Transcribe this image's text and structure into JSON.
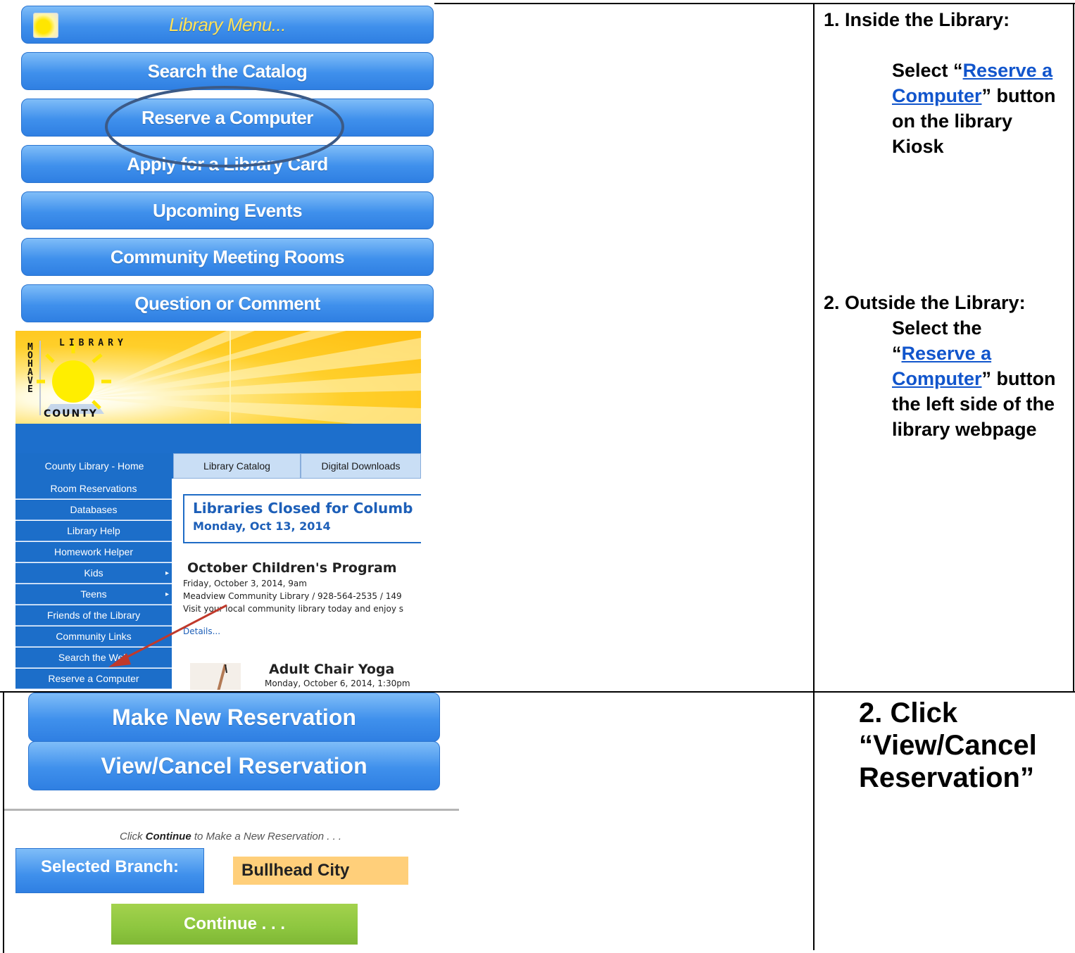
{
  "kiosk_menu": {
    "title": "Library Menu...",
    "buttons": [
      "Search the Catalog",
      "Reserve a Computer",
      "Apply for a Library Card",
      "Upcoming Events",
      "Community Meeting Rooms",
      "Question or Comment"
    ]
  },
  "website": {
    "logo_letters": {
      "left": "MOHAVE",
      "arc": "LIBRARY",
      "bottom": "COUNTY"
    },
    "top_nav": [
      "County Library - Home",
      "Library Catalog",
      "Digital Downloads"
    ],
    "side_nav": [
      "Room Reservations",
      "Databases",
      "Library Help",
      "Homework Helper",
      "Kids",
      "Teens",
      "Friends of the Library",
      "Community Links",
      "Search the Web",
      "Reserve a Computer"
    ],
    "notice_title": "Libraries Closed for Columb",
    "notice_date": "Monday, Oct 13, 2014",
    "event1_title": "October Children's Program",
    "event1_date": "Friday, October 3, 2014, 9am",
    "event1_location": "Meadview Community Library / 928-564-2535 / 149",
    "event1_desc": "Visit your local community library today and enjoy s",
    "event1_more": "Details...",
    "event2_title": "Adult Chair Yoga",
    "event2_date": "Monday, October 6, 2014, 1:30pm"
  },
  "instructions": {
    "step1_title": "1. Inside the Library:",
    "step1_pre": "Select “",
    "step1_link": "Reserve a Computer",
    "step1_post": "” button on the library Kiosk",
    "step2_title": "2. Outside the Library:",
    "step2_pre": "Select the “",
    "step2_link": "Reserve a Computer",
    "step2_post": "” button the left side of the library webpage",
    "step3_line1": "2.  Click",
    "step3_line2": "“View/Cancel",
    "step3_line3": "Reservation”"
  },
  "reservation": {
    "make_new": "Make New Reservation",
    "view_cancel": "View/Cancel Reservation",
    "hint_pre": "Click ",
    "hint_bold": "Continue",
    "hint_post": " to Make a New Reservation . . .",
    "branch_label": "Selected Branch:",
    "branch_value": "Bullhead City",
    "continue_label": "Continue . . ."
  },
  "colors": {
    "button_blue": "#3f90ec",
    "menu_title_yellow": "#ffe25a",
    "continue_green": "#8dc63f",
    "branch_orange": "#ffcf7a",
    "site_blue": "#1c6ec9"
  }
}
